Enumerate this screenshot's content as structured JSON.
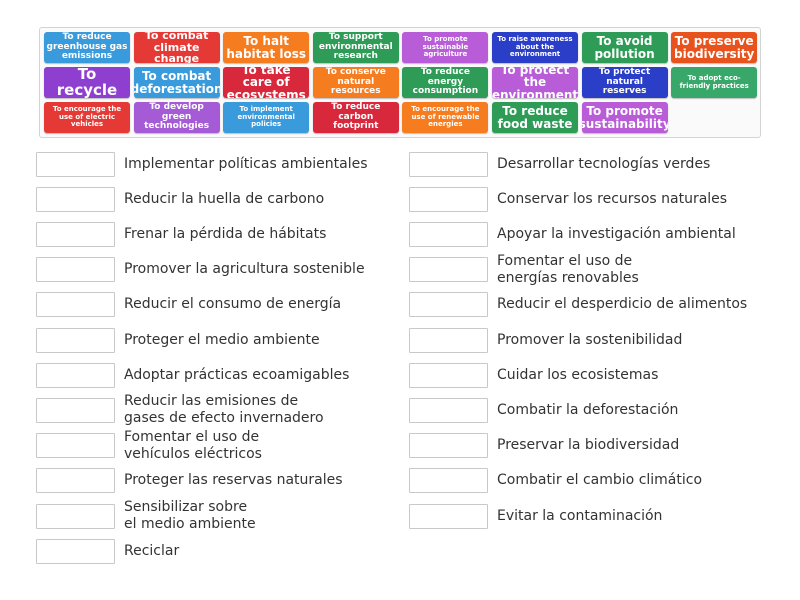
{
  "colors": {
    "blue": "#3a9bdc",
    "red": "#e53935",
    "orange": "#f57c1f",
    "green": "#2e9c57",
    "purple": "#a55bd6",
    "navy": "#2b3ec8",
    "crimson": "#d8283c",
    "magenta": "#b85cd8"
  },
  "tiles": [
    {
      "label": "To reduce greenhouse gas emissions",
      "color": "#3a9bdc"
    },
    {
      "label": "To combat climate change",
      "color": "#e53935"
    },
    {
      "label": "To halt habitat loss",
      "color": "#f57c1f"
    },
    {
      "label": "To support environmental research",
      "color": "#2e9c57"
    },
    {
      "label": "To promote sustainable agriculture",
      "color": "#b85cd8"
    },
    {
      "label": "To raise awareness about the environment",
      "color": "#2b3ec8"
    },
    {
      "label": "To avoid pollution",
      "color": "#2e9c57"
    },
    {
      "label": "To preserve biodiversity",
      "color": "#e8531d"
    },
    {
      "label": "To recycle",
      "color": "#8e3fd0"
    },
    {
      "label": "To combat deforestation",
      "color": "#3a9bdc"
    },
    {
      "label": "To take care of ecosystems",
      "color": "#d8283c"
    },
    {
      "label": "To conserve natural resources",
      "color": "#f57c1f"
    },
    {
      "label": "To reduce energy consumption",
      "color": "#2e9c57"
    },
    {
      "label": "To protect the environment",
      "color": "#b85cd8"
    },
    {
      "label": "To protect natural reserves",
      "color": "#2b3ec8"
    },
    {
      "label": "To adopt eco-friendly practices",
      "color": "#38a86a"
    },
    {
      "label": "To encourage the use of electric vehicles",
      "color": "#e53935"
    },
    {
      "label": "To develop green technologies",
      "color": "#a55bd6"
    },
    {
      "label": "To implement environmental policies",
      "color": "#3a9bdc"
    },
    {
      "label": "To reduce carbon footprint",
      "color": "#d8283c"
    },
    {
      "label": "To encourage the use of renewable energies",
      "color": "#f57c1f"
    },
    {
      "label": "To reduce food waste",
      "color": "#2e9c57"
    },
    {
      "label": "To promote sustainability",
      "color": "#b85cd8"
    }
  ],
  "left_items": [
    {
      "label": "Implementar políticas ambientales"
    },
    {
      "label": "Reducir la huella de carbono"
    },
    {
      "label": "Frenar la pérdida de hábitats"
    },
    {
      "label": "Promover la agricultura sostenible"
    },
    {
      "label": "Reducir el consumo de energía"
    },
    {
      "label": "Proteger el medio ambiente"
    },
    {
      "label": "Adoptar prácticas ecoamigables"
    },
    {
      "label": "Reducir las emisiones de\ngases de efecto invernadero"
    },
    {
      "label": "Fomentar el uso de\nvehículos eléctricos"
    },
    {
      "label": "Proteger las reservas naturales"
    },
    {
      "label": "Sensibilizar sobre\nel medio ambiente"
    },
    {
      "label": "Reciclar"
    }
  ],
  "right_items": [
    {
      "label": "Desarrollar tecnologías verdes"
    },
    {
      "label": "Conservar los recursos naturales"
    },
    {
      "label": "Apoyar la investigación ambiental"
    },
    {
      "label": "Fomentar el uso de\nenergías renovables"
    },
    {
      "label": "Reducir el desperdicio de alimentos"
    },
    {
      "label": "Promover la sostenibilidad"
    },
    {
      "label": "Cuidar los ecosistemas"
    },
    {
      "label": "Combatir la deforestación"
    },
    {
      "label": "Preservar la biodiversidad"
    },
    {
      "label": "Combatir el cambio climático"
    },
    {
      "label": "Evitar la contaminación"
    }
  ]
}
